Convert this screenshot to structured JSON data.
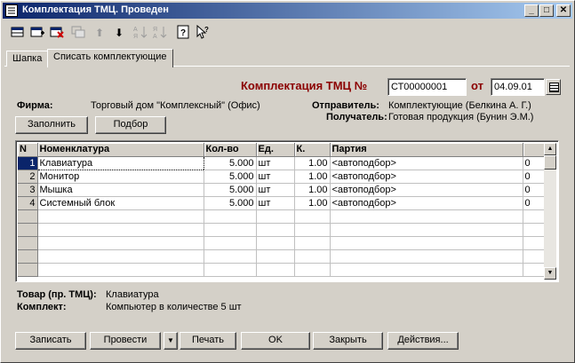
{
  "window": {
    "title": "Комплектация ТМЦ. Проведен",
    "controls": {
      "minimize": "_",
      "maximize": "□",
      "close": "✕"
    }
  },
  "toolbar": {
    "icons": [
      "new-row-icon",
      "add-row-icon",
      "delete-row-icon",
      "copy-row-icon",
      "move-up-icon",
      "move-down-icon",
      "sort-asc-icon",
      "sort-desc-icon",
      "help-icon",
      "context-help-icon"
    ],
    "glyphs": {
      "move_up": "⬆",
      "move_down": "⬇",
      "help": "?"
    }
  },
  "tabs": [
    "Шапка",
    "Списать комплектующие"
  ],
  "document": {
    "title_label": "Комплектация ТМЦ №",
    "number": "СТ00000001",
    "date_label": "от",
    "date": "04.09.01"
  },
  "header": {
    "firma_label": "Фирма:",
    "firma_value": "Торговый дом \"Комплексный\" (Офис)",
    "sender_label": "Отправитель:",
    "sender_value": "Комплектующие (Белкина А. Г.)",
    "receiver_label": "Получатель:",
    "receiver_value": "Готовая продукция (Бунин Э.М.)"
  },
  "actions": {
    "fill": "Заполнить",
    "select": "Подбор"
  },
  "table": {
    "columns": [
      "N",
      "Номенклатура",
      "Кол-во",
      "Ед.",
      "К.",
      "Партия",
      ""
    ],
    "rows": [
      [
        "1",
        "Клавиатура",
        "5.000",
        "шт",
        "1.00",
        "<автоподбор>",
        "0"
      ],
      [
        "2",
        "Монитор",
        "5.000",
        "шт",
        "1.00",
        "<автоподбор>",
        "0"
      ],
      [
        "3",
        "Мышка",
        "5.000",
        "шт",
        "1.00",
        "<автоподбор>",
        "0"
      ],
      [
        "4",
        "Системный блок",
        "5.000",
        "шт",
        "1.00",
        "<автоподбор>",
        "0"
      ]
    ],
    "selected_row": 1
  },
  "footer": {
    "item_label": "Товар (пр. ТМЦ):",
    "item_value": "Клавиатура",
    "set_label": "Комплект:",
    "set_value": "Компьютер в количестве 5 шт"
  },
  "buttons": {
    "save": "Записать",
    "post": "Провести",
    "post_dropdown": "▼",
    "print": "Печать",
    "ok": "OK",
    "close": "Закрыть",
    "actions": "Действия..."
  },
  "scrollbar": {
    "up": "▲",
    "down": "▼"
  }
}
